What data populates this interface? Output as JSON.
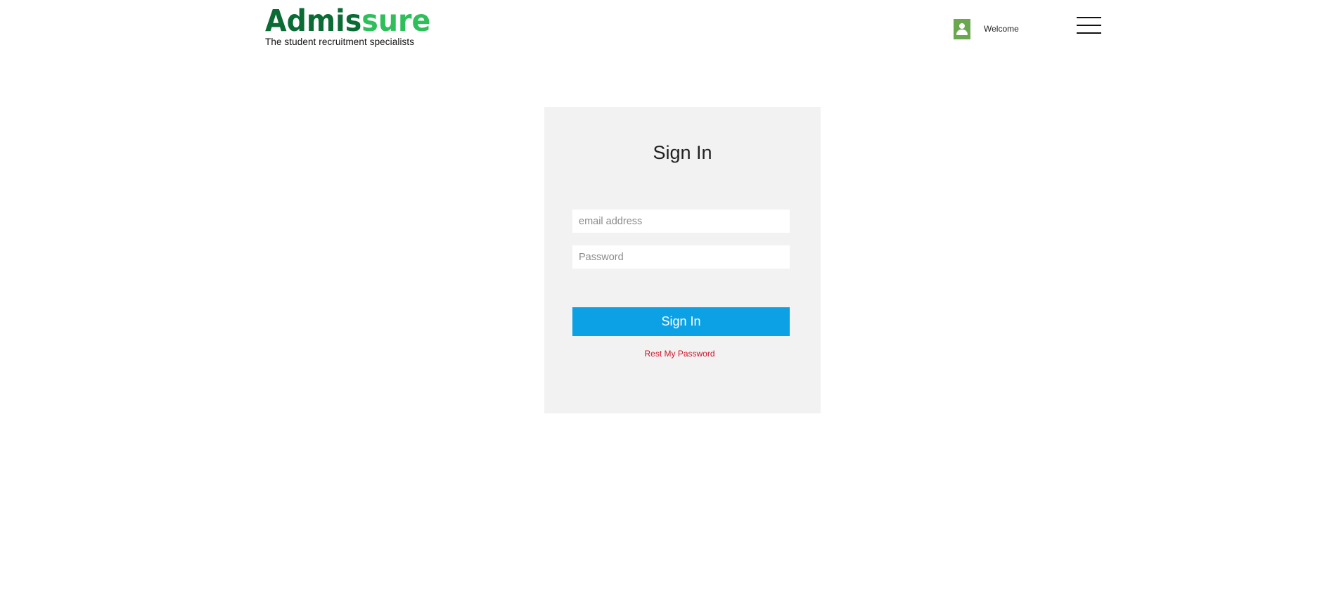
{
  "header": {
    "logo_part1": "Admis",
    "logo_part2": "sure",
    "tagline": "The student recruitment specialists",
    "welcome": "Welcome",
    "user_icon": "user-icon",
    "menu_icon": "hamburger-menu-icon"
  },
  "signin": {
    "title": "Sign In",
    "email_placeholder": "email address",
    "email_value": "",
    "password_placeholder": "Password",
    "password_value": "",
    "button_label": "Sign In",
    "reset_label": "Rest My Password"
  },
  "colors": {
    "brand_dark_green": "#0a6b34",
    "brand_light_green": "#2dbf5a",
    "user_icon_bg": "#6aa84f",
    "panel_bg": "#f2f2f2",
    "button_bg": "#0ba1e4",
    "reset_link": "#d0142a"
  }
}
